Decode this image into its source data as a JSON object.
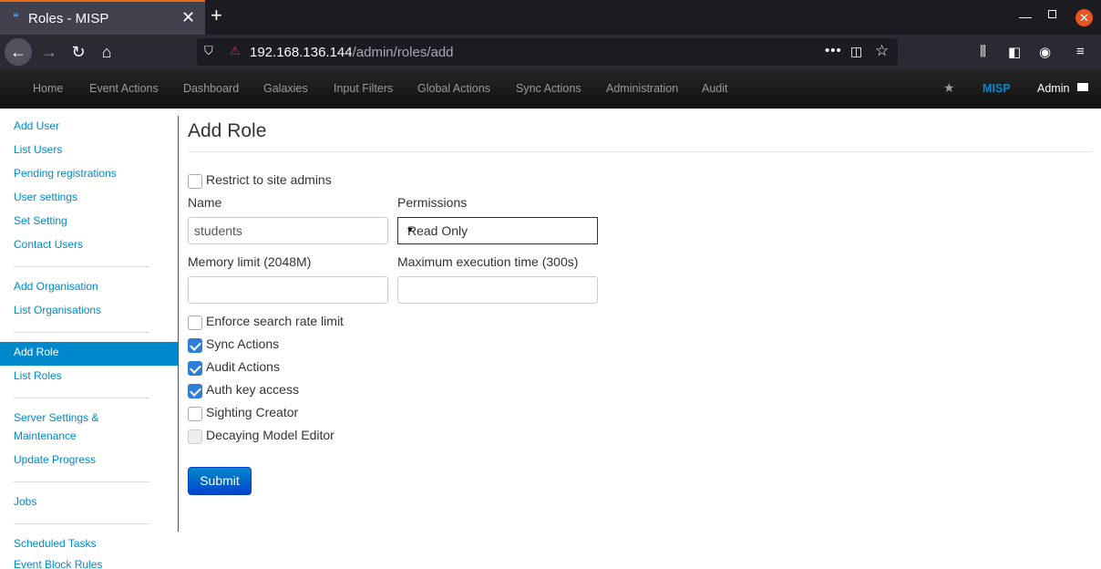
{
  "browser": {
    "tab_title": "Roles - MISP",
    "url_host": "192.168.136.144",
    "url_path": "/admin/roles/add"
  },
  "nav": {
    "items": [
      "Home",
      "Event Actions",
      "Dashboard",
      "Galaxies",
      "Input Filters",
      "Global Actions",
      "Sync Actions",
      "Administration",
      "Audit"
    ],
    "brand": "MISP",
    "user": "Admin"
  },
  "sidebar": {
    "items": [
      "Add User",
      "List Users",
      "Pending registrations",
      "User settings",
      "Set Setting",
      "Contact Users",
      "Add Organisation",
      "List Organisations",
      "Add Role",
      "List Roles",
      "Server Settings &",
      "Maintenance",
      "Update Progress",
      "Jobs",
      "Scheduled Tasks",
      "Event Block Rules"
    ],
    "active": "Add Role"
  },
  "form": {
    "title": "Add Role",
    "restrict_label": "Restrict to site admins",
    "name_label": "Name",
    "name_value": "students",
    "permissions_label": "Permissions",
    "permissions_value": "Read Only",
    "memory_label": "Memory limit (2048M)",
    "memory_value": "",
    "exec_label": "Maximum execution time (300s)",
    "exec_value": "",
    "checkboxes": [
      {
        "label": "Enforce search rate limit",
        "checked": false
      },
      {
        "label": "Sync Actions",
        "checked": true
      },
      {
        "label": "Audit Actions",
        "checked": true
      },
      {
        "label": "Auth key access",
        "checked": true
      },
      {
        "label": "Sighting Creator",
        "checked": false
      },
      {
        "label": "Decaying Model Editor",
        "checked": false
      }
    ],
    "submit_label": "Submit"
  }
}
